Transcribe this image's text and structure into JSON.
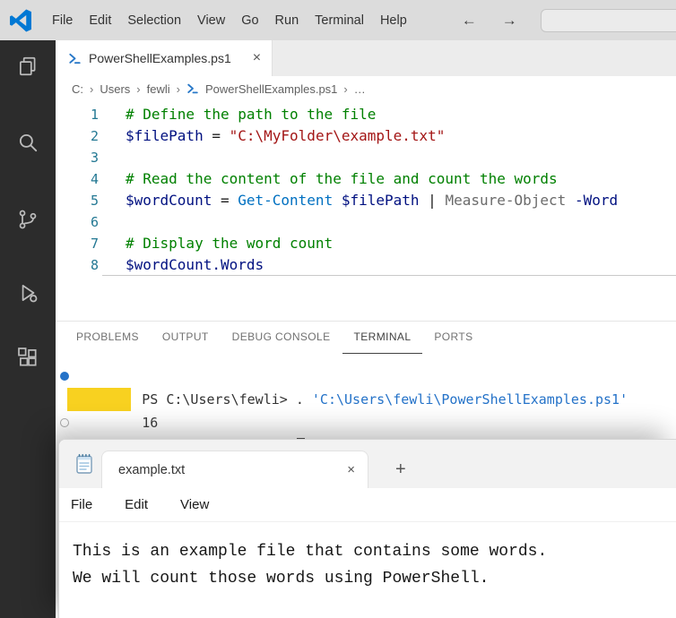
{
  "titlebar": {
    "menus": [
      "File",
      "Edit",
      "Selection",
      "View",
      "Go",
      "Run",
      "Terminal",
      "Help"
    ]
  },
  "icons": {
    "close": "×",
    "new_tab": "+",
    "back": "←",
    "forward": "→",
    "chevron": "›"
  },
  "activity_bar": {
    "items": [
      "explorer",
      "search",
      "source-control",
      "run-and-debug",
      "extensions"
    ]
  },
  "editor": {
    "tab_label": "PowerShellExamples.ps1",
    "lines": [
      {
        "num": "1",
        "tokens": [
          {
            "c": "comment",
            "t": "# Define the path to the file"
          }
        ]
      },
      {
        "num": "2",
        "tokens": [
          {
            "c": "variable",
            "t": "$filePath"
          },
          {
            "c": "plain",
            "t": " = "
          },
          {
            "c": "string",
            "t": "\"C:\\MyFolder\\example.txt\""
          }
        ]
      },
      {
        "num": "3",
        "tokens": []
      },
      {
        "num": "4",
        "tokens": [
          {
            "c": "comment",
            "t": "# Read the content of the file and count the words"
          }
        ]
      },
      {
        "num": "5",
        "tokens": [
          {
            "c": "variable",
            "t": "$wordCount"
          },
          {
            "c": "plain",
            "t": " = "
          },
          {
            "c": "cmdlet",
            "t": "Get-Content"
          },
          {
            "c": "plain",
            "t": " "
          },
          {
            "c": "variable",
            "t": "$filePath"
          },
          {
            "c": "plain",
            "t": " | "
          },
          {
            "c": "cmdlet2",
            "t": "Measure-Object"
          },
          {
            "c": "param",
            "t": " -Word"
          }
        ]
      },
      {
        "num": "6",
        "tokens": []
      },
      {
        "num": "7",
        "tokens": [
          {
            "c": "comment",
            "t": "# Display the word count"
          }
        ]
      },
      {
        "num": "8",
        "current": true,
        "tokens": [
          {
            "c": "variable",
            "t": "$wordCount"
          },
          {
            "c": "property",
            "t": ".Words"
          }
        ]
      }
    ]
  },
  "breadcrumb": {
    "items": [
      "C:",
      "Users",
      "fewli"
    ],
    "file": "PowerShellExamples.ps1",
    "more": "…"
  },
  "panel": {
    "tabs": [
      {
        "label": "PROBLEMS"
      },
      {
        "label": "OUTPUT"
      },
      {
        "label": "DEBUG CONSOLE"
      },
      {
        "label": "TERMINAL",
        "active": true
      },
      {
        "label": "PORTS"
      }
    ]
  },
  "terminal": {
    "command_prefix": "PS C:\\Users\\fewli> . ",
    "script_path": "'C:\\Users\\fewli\\PowerShellExamples.ps1'",
    "output": "16",
    "prompt": "PS C:\\Users\\fewli> "
  },
  "notepad": {
    "tab_label": "example.txt",
    "menus": [
      "File",
      "Edit",
      "View"
    ],
    "content_lines": [
      "This is an example file that contains some words.",
      "We will count those words using PowerShell."
    ]
  },
  "colors": {
    "accent_blue": "#0078d4",
    "comment_green": "#008000",
    "string_red": "#a31515",
    "variable_navy": "#001080",
    "cmdlet_blue": "#0070c1",
    "terminal_blue": "#2472c8",
    "highlight_yellow": "#f8d120",
    "activity_bar_bg": "#2c2c2c",
    "titlebar_bg": "#dcdcdc"
  }
}
